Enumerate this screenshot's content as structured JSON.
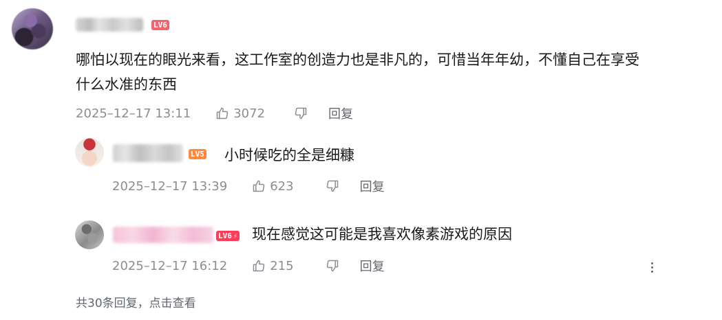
{
  "main_comment": {
    "level_badge": "LV6",
    "content_line1": "哪怕以现在的眼光来看，这工作室的创造力也是非凡的，可惜当年年幼，不懂自己在享受",
    "content_line2": "什么水准的东西",
    "time": "2025–12–17 13:11",
    "likes": "3072",
    "reply_label": "回复"
  },
  "replies": [
    {
      "level_badge": "LV5",
      "content": "小时候吃的全是细糠",
      "time": "2025–12–17 13:39",
      "likes": "623",
      "reply_label": "回复"
    },
    {
      "level_badge": "LV6",
      "level_bolt": "⚡",
      "content": "现在感觉这可能是我喜欢像素游戏的原因",
      "time": "2025–12–17 16:12",
      "likes": "215",
      "reply_label": "回复"
    }
  ],
  "footer": {
    "view_more": "共30条回复，点击查看"
  },
  "colors": {
    "text": "#18191c",
    "meta": "#8b8d92",
    "lv6": "#f0646e",
    "lv5": "#ff8a3d",
    "lv6_hardcore": "#ff3c5a"
  },
  "icons": [
    "thumbs-up-icon",
    "thumbs-down-icon",
    "more-vertical-icon"
  ]
}
